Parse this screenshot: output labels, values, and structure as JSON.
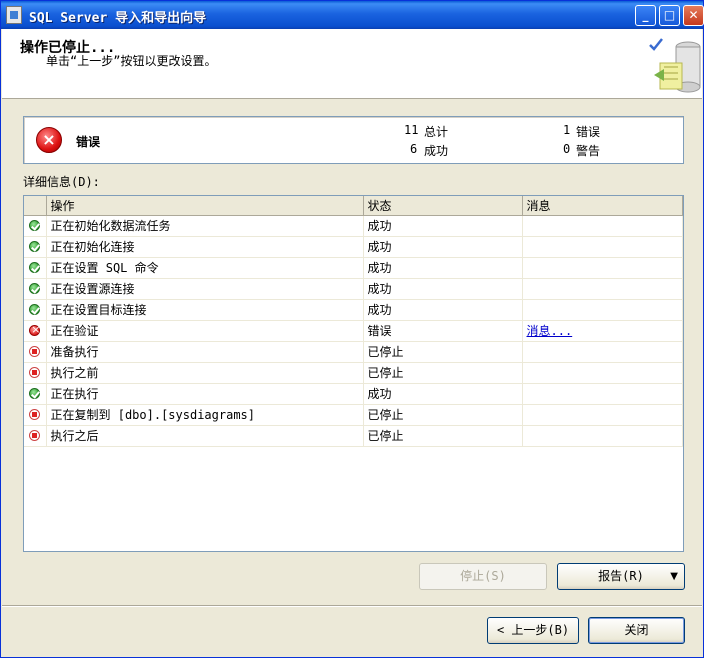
{
  "window": {
    "title": "SQL Server 导入和导出向导"
  },
  "header": {
    "title": "操作已停止...",
    "subtitle": "单击“上一步”按钮以更改设置。"
  },
  "summary": {
    "status": "错误",
    "total_count": "11",
    "total_label": "总计",
    "success_count": "6",
    "success_label": "成功",
    "error_count": "1",
    "error_label": "错误",
    "warning_count": "0",
    "warning_label": "警告"
  },
  "details": {
    "label": "详细信息(D):",
    "columns": [
      "操作",
      "状态",
      "消息"
    ],
    "rows": [
      {
        "icon": "success-icon",
        "action": "正在初始化数据流任务",
        "status": "成功",
        "message": ""
      },
      {
        "icon": "success-icon",
        "action": "正在初始化连接",
        "status": "成功",
        "message": ""
      },
      {
        "icon": "success-icon",
        "action": "正在设置 SQL 命令",
        "status": "成功",
        "message": ""
      },
      {
        "icon": "success-icon",
        "action": "正在设置源连接",
        "status": "成功",
        "message": ""
      },
      {
        "icon": "success-icon",
        "action": "正在设置目标连接",
        "status": "成功",
        "message": ""
      },
      {
        "icon": "error-icon",
        "action": "正在验证",
        "status": "错误",
        "message": "消息..."
      },
      {
        "icon": "stopped-icon",
        "action": "准备执行",
        "status": "已停止",
        "message": ""
      },
      {
        "icon": "stopped-icon",
        "action": "执行之前",
        "status": "已停止",
        "message": ""
      },
      {
        "icon": "success-icon",
        "action": "正在执行",
        "status": "成功",
        "message": ""
      },
      {
        "icon": "stopped-icon",
        "action": "正在复制到 [dbo].[sysdiagrams]",
        "status": "已停止",
        "message": ""
      },
      {
        "icon": "stopped-icon",
        "action": "执行之后",
        "status": "已停止",
        "message": ""
      }
    ]
  },
  "buttons": {
    "stop": "停止(S)",
    "report": "报告(R)",
    "back": "< 上一步(B)",
    "close": "关闭"
  },
  "colors": {
    "title_bar": "#0a4fcf",
    "error": "#dd1111",
    "success": "#2b9a2b",
    "link": "#0000cc"
  }
}
